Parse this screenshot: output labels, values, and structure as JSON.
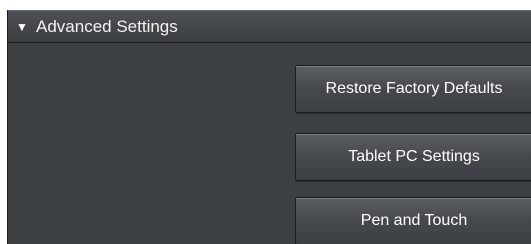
{
  "section": {
    "toggle_icon": "▼",
    "title": "Advanced Settings"
  },
  "buttons": {
    "restore_label": "Restore Factory Defaults",
    "tablet_label": "Tablet PC Settings",
    "pen_label": "Pen and Touch"
  },
  "colors": {
    "panel_background": "#3c4043",
    "button_text": "#ffffff"
  }
}
